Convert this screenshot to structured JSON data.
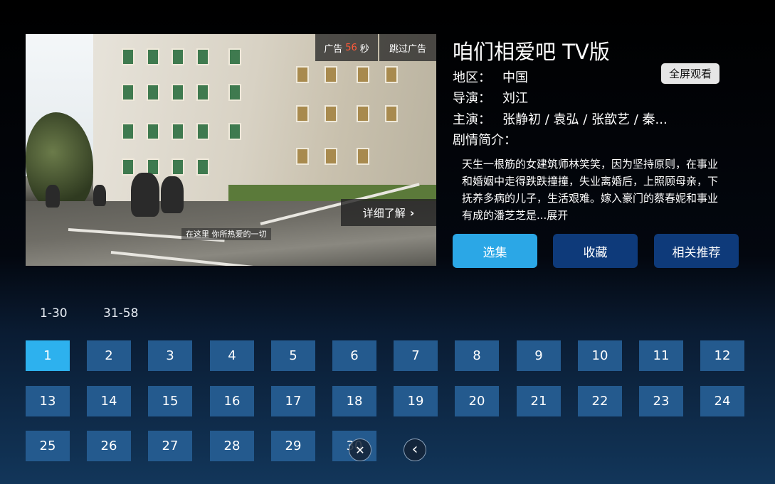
{
  "video": {
    "ad_label": "广告",
    "ad_seconds": "56",
    "ad_unit": "秒",
    "skip_ad": "跳过广告",
    "more_details": "详细了解",
    "subtitle": "在这里 你所热爱的一切"
  },
  "info": {
    "title": "咱们相爱吧 TV版",
    "fullscreen": "全屏观看",
    "region_label": "地区：",
    "region": "中国",
    "director_label": "导演：",
    "director": "刘江",
    "cast_label": "主演：",
    "cast": "张静初 / 袁弘 / 张歆艺 / 秦...",
    "synopsis_label": "剧情简介：",
    "synopsis": "天生一根筋的女建筑师林笑笑，因为坚持原则，在事业和婚姻中走得跌跌撞撞，失业离婚后，上照顾母亲，下抚养多病的儿子，生活艰难。嫁入豪门的蔡春妮和事业有成的潘芝芝是...展开"
  },
  "actions": {
    "select_episode": "选集",
    "favorite": "收藏",
    "related": "相关推荐"
  },
  "episode_ranges": [
    "1-30",
    "31-58"
  ],
  "episodes": [
    "1",
    "2",
    "3",
    "4",
    "5",
    "6",
    "7",
    "8",
    "9",
    "10",
    "11",
    "12",
    "13",
    "14",
    "15",
    "16",
    "17",
    "18",
    "19",
    "20",
    "21",
    "22",
    "23",
    "24",
    "25",
    "26",
    "27",
    "28",
    "29",
    "30"
  ],
  "selected_episode": "1",
  "overlay": {
    "close_icon": "✕",
    "back_icon": "‹"
  },
  "colors": {
    "accent": "#2db1ee",
    "tile": "#245a8e",
    "button_dark": "#0e3a7a",
    "ad_seconds": "#ff5a3a"
  }
}
